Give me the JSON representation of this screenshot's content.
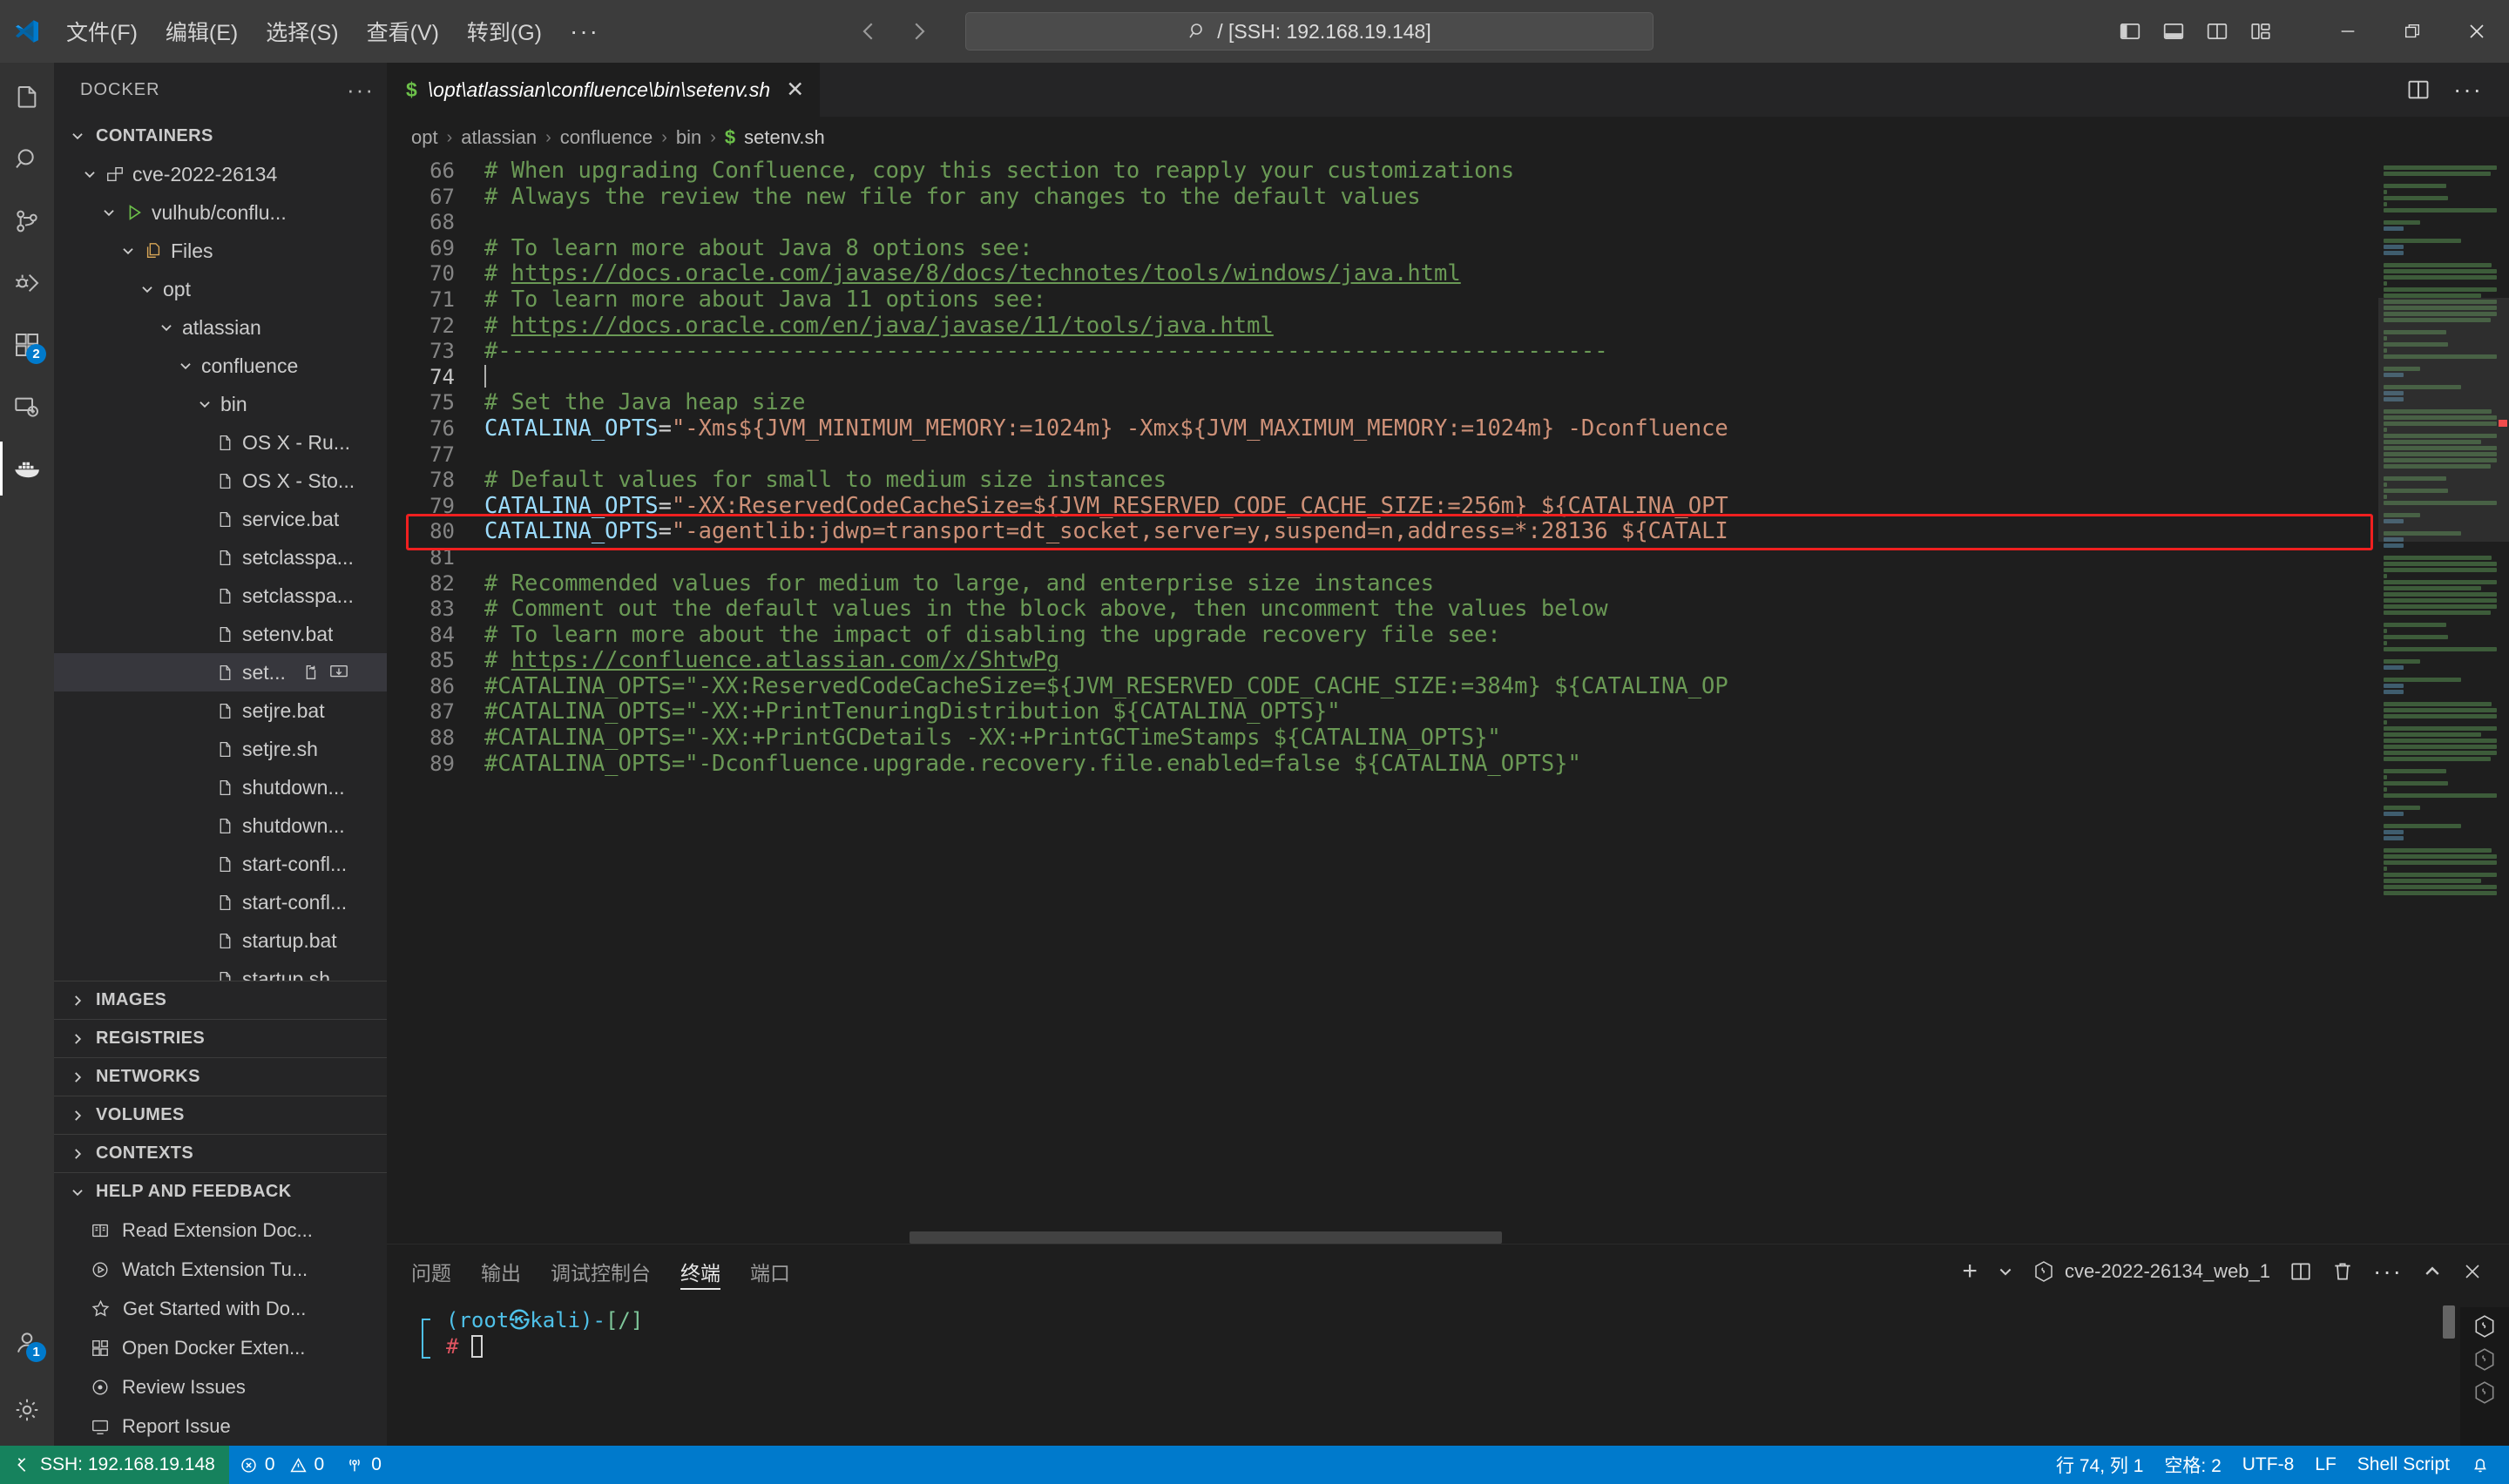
{
  "titlebar": {
    "menus": [
      "文件(F)",
      "编辑(E)",
      "选择(S)",
      "查看(V)",
      "转到(G)"
    ],
    "more": "···",
    "quickinput": "/ [SSH: 192.168.19.148]",
    "back_arrow": "‹",
    "forward_arrow": "›"
  },
  "activitybar": {
    "items": [
      {
        "name": "explorer",
        "badge": ""
      },
      {
        "name": "search",
        "badge": ""
      },
      {
        "name": "source-control",
        "badge": ""
      },
      {
        "name": "run-and-debug",
        "badge": ""
      },
      {
        "name": "extensions",
        "badge": "2"
      },
      {
        "name": "remote-explorer",
        "badge": ""
      },
      {
        "name": "docker",
        "badge": ""
      }
    ],
    "accounts_badge": "1"
  },
  "sidebar": {
    "title": "DOCKER",
    "more": "···",
    "containers_section": "CONTAINERS",
    "tree": [
      {
        "label": "cve-2022-26134",
        "depth": 1,
        "icon": "container-icon",
        "twisty": "chevron-down"
      },
      {
        "label": "vulhub/conflu...",
        "depth": 2,
        "icon": "play-icon",
        "twisty": "chevron-down"
      },
      {
        "label": "Files",
        "depth": 3,
        "icon": "files-icon",
        "twisty": "chevron-down"
      },
      {
        "label": "opt",
        "depth": 4,
        "icon": "",
        "twisty": "chevron-down"
      },
      {
        "label": "atlassian",
        "depth": 5,
        "icon": "",
        "twisty": "chevron-down"
      },
      {
        "label": "confluence",
        "depth": 6,
        "icon": "",
        "twisty": "chevron-down"
      },
      {
        "label": "bin",
        "depth": 7,
        "icon": "",
        "twisty": "chevron-down"
      },
      {
        "label": "OS X - Ru...",
        "depth": 8,
        "icon": "file-icon",
        "twisty": ""
      },
      {
        "label": "OS X - Sto...",
        "depth": 8,
        "icon": "file-icon",
        "twisty": ""
      },
      {
        "label": "service.bat",
        "depth": 8,
        "icon": "file-icon",
        "twisty": ""
      },
      {
        "label": "setclasspa...",
        "depth": 8,
        "icon": "file-icon",
        "twisty": ""
      },
      {
        "label": "setclasspa...",
        "depth": 8,
        "icon": "file-icon",
        "twisty": ""
      },
      {
        "label": "setenv.bat",
        "depth": 8,
        "icon": "file-icon",
        "twisty": ""
      },
      {
        "label": "set...",
        "depth": 8,
        "icon": "file-icon",
        "twisty": "",
        "selected": true,
        "actions": [
          "open-file-icon",
          "download-icon"
        ]
      },
      {
        "label": "setjre.bat",
        "depth": 8,
        "icon": "file-icon",
        "twisty": ""
      },
      {
        "label": "setjre.sh",
        "depth": 8,
        "icon": "file-icon",
        "twisty": ""
      },
      {
        "label": "shutdown...",
        "depth": 8,
        "icon": "file-icon",
        "twisty": ""
      },
      {
        "label": "shutdown...",
        "depth": 8,
        "icon": "file-icon",
        "twisty": ""
      },
      {
        "label": "start-confl...",
        "depth": 8,
        "icon": "file-icon",
        "twisty": ""
      },
      {
        "label": "start-confl...",
        "depth": 8,
        "icon": "file-icon",
        "twisty": ""
      },
      {
        "label": "startup.bat",
        "depth": 8,
        "icon": "file-icon",
        "twisty": ""
      },
      {
        "label": "startup.sh",
        "depth": 8,
        "icon": "file-icon",
        "twisty": ""
      }
    ],
    "sections": [
      "IMAGES",
      "REGISTRIES",
      "NETWORKS",
      "VOLUMES",
      "CONTEXTS"
    ],
    "help_section": "HELP AND FEEDBACK",
    "help_items": [
      {
        "label": "Read Extension Doc...",
        "icon": "book-icon"
      },
      {
        "label": "Watch Extension Tu...",
        "icon": "play-circle-icon"
      },
      {
        "label": "Get Started with Do...",
        "icon": "star-icon"
      },
      {
        "label": "Open Docker Exten...",
        "icon": "extensions-icon"
      },
      {
        "label": "Review Issues",
        "icon": "issues-icon"
      },
      {
        "label": "Report Issue",
        "icon": "report-icon"
      }
    ]
  },
  "editor": {
    "tab": {
      "prefix": "$",
      "title": "\\opt\\atlassian\\confluence\\bin\\setenv.sh",
      "close": "✕"
    },
    "breadcrumbs": [
      "opt",
      "atlassian",
      "confluence",
      "bin",
      "setenv.sh"
    ],
    "breadcrumb_file_icon": "$",
    "lines": [
      {
        "n": "66",
        "segments": [
          {
            "t": "# When upgrading Confluence, copy this section to reapply your customizations",
            "c": "c-comment"
          }
        ]
      },
      {
        "n": "67",
        "segments": [
          {
            "t": "# Always the review the new file for any changes to the default values",
            "c": "c-comment"
          }
        ]
      },
      {
        "n": "68",
        "segments": []
      },
      {
        "n": "69",
        "segments": [
          {
            "t": "# To learn more about Java 8 options see:",
            "c": "c-comment"
          }
        ]
      },
      {
        "n": "70",
        "segments": [
          {
            "t": "# ",
            "c": "c-comment"
          },
          {
            "t": "https://docs.oracle.com/javase/8/docs/technotes/tools/windows/java.html",
            "c": "c-link"
          }
        ]
      },
      {
        "n": "71",
        "segments": [
          {
            "t": "# To learn more about Java 11 options see:",
            "c": "c-comment"
          }
        ]
      },
      {
        "n": "72",
        "segments": [
          {
            "t": "# ",
            "c": "c-comment"
          },
          {
            "t": "https://docs.oracle.com/en/java/javase/11/tools/java.html",
            "c": "c-link"
          }
        ]
      },
      {
        "n": "73",
        "segments": [
          {
            "t": "#-----------------------------------------------------------------------------------",
            "c": "c-comment"
          }
        ]
      },
      {
        "n": "74",
        "segments": [],
        "cursor": true
      },
      {
        "n": "75",
        "segments": [
          {
            "t": "# Set the Java heap size",
            "c": "c-comment"
          }
        ]
      },
      {
        "n": "76",
        "segments": [
          {
            "t": "CATALINA_OPTS",
            "c": "c-var"
          },
          {
            "t": "=",
            "c": "c-plain"
          },
          {
            "t": "\"-Xms${JVM_MINIMUM_MEMORY:=1024m} -Xmx${JVM_MAXIMUM_MEMORY:=1024m} -Dconfluence",
            "c": "c-str"
          }
        ]
      },
      {
        "n": "77",
        "segments": []
      },
      {
        "n": "78",
        "segments": [
          {
            "t": "# Default values for small to medium size instances",
            "c": "c-comment"
          }
        ]
      },
      {
        "n": "79",
        "segments": [
          {
            "t": "CATALINA_OPTS",
            "c": "c-var"
          },
          {
            "t": "=",
            "c": "c-plain"
          },
          {
            "t": "\"-XX:ReservedCodeCacheSize=${JVM_RESERVED_CODE_CACHE_SIZE:=256m} ${CATALINA_OPT",
            "c": "c-str"
          }
        ]
      },
      {
        "n": "80",
        "segments": [
          {
            "t": "CATALINA_OPTS",
            "c": "c-var"
          },
          {
            "t": "=",
            "c": "c-plain"
          },
          {
            "t": "\"-agentlib:jdwp=transport=dt_socket,server=y,suspend=n,address=*:28136 ${CATALI",
            "c": "c-str"
          }
        ],
        "highlight": true
      },
      {
        "n": "81",
        "segments": []
      },
      {
        "n": "82",
        "segments": [
          {
            "t": "# Recommended values for medium to large, and enterprise size instances",
            "c": "c-comment"
          }
        ]
      },
      {
        "n": "83",
        "segments": [
          {
            "t": "# Comment out the default values in the block above, then uncomment the values below",
            "c": "c-comment"
          }
        ]
      },
      {
        "n": "84",
        "segments": [
          {
            "t": "# To learn more about the impact of disabling the upgrade recovery file see:",
            "c": "c-comment"
          }
        ]
      },
      {
        "n": "85",
        "segments": [
          {
            "t": "# ",
            "c": "c-comment"
          },
          {
            "t": "https://confluence.atlassian.com/x/ShtwPg",
            "c": "c-link"
          }
        ]
      },
      {
        "n": "86",
        "segments": [
          {
            "t": "#CATALINA_OPTS=\"-XX:ReservedCodeCacheSize=${JVM_RESERVED_CODE_CACHE_SIZE:=384m} ${CATALINA_OP",
            "c": "c-comment"
          }
        ]
      },
      {
        "n": "87",
        "segments": [
          {
            "t": "#CATALINA_OPTS=\"-XX:+PrintTenuringDistribution ${CATALINA_OPTS}\"",
            "c": "c-comment"
          }
        ]
      },
      {
        "n": "88",
        "segments": [
          {
            "t": "#CATALINA_OPTS=\"-XX:+PrintGCDetails -XX:+PrintGCTimeStamps ${CATALINA_OPTS}\"",
            "c": "c-comment"
          }
        ]
      },
      {
        "n": "89",
        "segments": [
          {
            "t": "#CATALINA_OPTS=\"-Dconfluence.upgrade.recovery.file.enabled=false ${CATALINA_OPTS}\"",
            "c": "c-comment"
          }
        ]
      }
    ]
  },
  "panel": {
    "tabs": [
      "问题",
      "输出",
      "调试控制台",
      "终端",
      "端口"
    ],
    "active_tab": "终端",
    "terminal_name": "cve-2022-26134_web_1",
    "add_label": "+",
    "terminal": {
      "prompt_user": "(root㉿kali)",
      "prompt_dash": "-",
      "prompt_path": "[/]",
      "prompt_symbol": "#"
    }
  },
  "statusbar": {
    "remote": "SSH: 192.168.19.148",
    "errors": "0",
    "warnings": "0",
    "ports": "0",
    "cursor_position": "行 74, 列 1",
    "indent": "空格: 2",
    "encoding": "UTF-8",
    "eol": "LF",
    "language": "Shell Script"
  },
  "colors": {
    "accent": "#007acc",
    "remote_green": "#16825d",
    "highlight_red": "#f02020",
    "comment_green": "#6a9955",
    "string_orange": "#ce9178",
    "var_blue": "#9cdcfe"
  }
}
